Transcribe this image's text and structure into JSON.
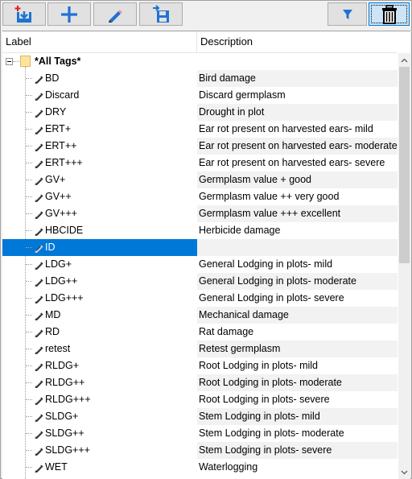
{
  "toolbar": {
    "buttons": [
      {
        "name": "import-icon"
      },
      {
        "name": "add-icon"
      },
      {
        "name": "edit-pencil-icon"
      },
      {
        "name": "save-icon"
      },
      {
        "name": "filter-icon"
      },
      {
        "name": "trash-icon"
      }
    ]
  },
  "grid": {
    "columns": {
      "label": "Label",
      "description": "Description"
    },
    "root": {
      "label": "*All Tags*"
    },
    "rows": [
      {
        "label": "BD",
        "description": "Bird damage"
      },
      {
        "label": "Discard",
        "description": "Discard germplasm"
      },
      {
        "label": "DRY",
        "description": "Drought in plot"
      },
      {
        "label": "ERT+",
        "description": "Ear rot present on harvested ears- mild"
      },
      {
        "label": "ERT++",
        "description": "Ear rot present on harvested ears- moderate"
      },
      {
        "label": "ERT+++",
        "description": "Ear rot present on harvested ears- severe"
      },
      {
        "label": "GV+",
        "description": "Germplasm value + good"
      },
      {
        "label": "GV++",
        "description": "Germplasm value ++ very good"
      },
      {
        "label": "GV+++",
        "description": "Germplasm value +++ excellent"
      },
      {
        "label": "HBCIDE",
        "description": "Herbicide damage"
      },
      {
        "label": "ID",
        "description": ""
      },
      {
        "label": "LDG+",
        "description": "General Lodging in plots- mild"
      },
      {
        "label": "LDG++",
        "description": "General Lodging in plots- moderate"
      },
      {
        "label": "LDG+++",
        "description": "General Lodging in plots- severe"
      },
      {
        "label": "MD",
        "description": "Mechanical damage"
      },
      {
        "label": "RD",
        "description": "Rat damage"
      },
      {
        "label": "retest",
        "description": "Retest germplasm"
      },
      {
        "label": "RLDG+",
        "description": "Root Lodging in plots- mild"
      },
      {
        "label": "RLDG++",
        "description": "Root Lodging in plots- moderate"
      },
      {
        "label": "RLDG+++",
        "description": "Root Lodging in plots- severe"
      },
      {
        "label": "SLDG+",
        "description": "Stem Lodging in plots- mild"
      },
      {
        "label": "SLDG++",
        "description": "Stem Lodging in plots- moderate"
      },
      {
        "label": "SLDG+++",
        "description": "Stem Lodging in plots- severe"
      },
      {
        "label": "WET",
        "description": "Waterlogging"
      }
    ],
    "selected_label": "ID"
  },
  "colors": {
    "selection": "#0078d7",
    "accent_blue": "#1e73d2",
    "alt_row": "#f2f2f2"
  }
}
